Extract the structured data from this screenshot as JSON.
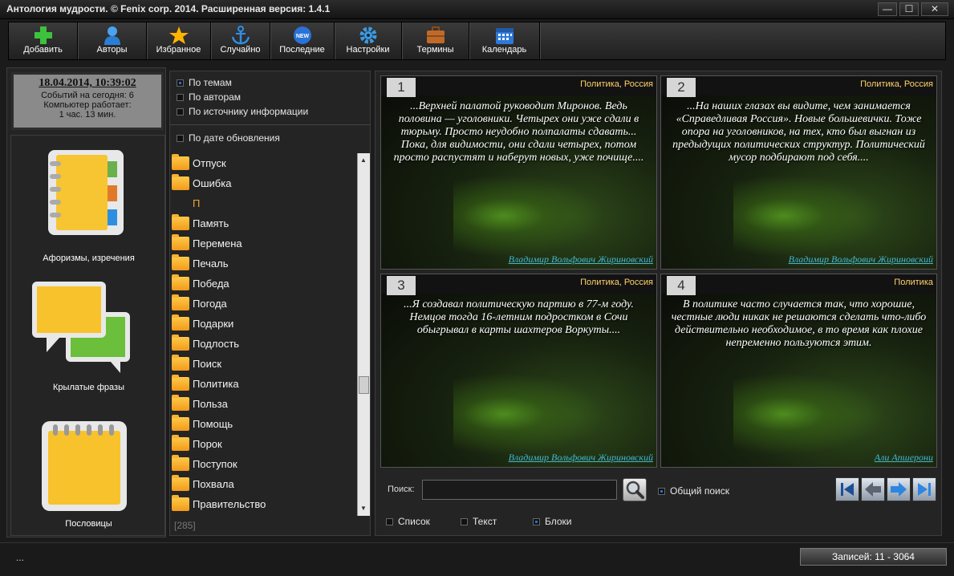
{
  "window": {
    "title": "Антология мудрости. © Fenix corp. 2014. Расширенная версия: 1.4.1",
    "min": "—",
    "max": "☐",
    "close": "✕"
  },
  "toolbar": [
    {
      "label": "Добавить",
      "icon": "plus-icon",
      "color": "#3cc23c"
    },
    {
      "label": "Авторы",
      "icon": "user-icon",
      "color": "#3a8fe0"
    },
    {
      "label": "Избранное",
      "icon": "star-icon",
      "color": "#ffb400"
    },
    {
      "label": "Случайно",
      "icon": "anchor-icon",
      "color": "#2e8fe6"
    },
    {
      "label": "Последние",
      "icon": "new-badge-icon",
      "color": "#2a72d6"
    },
    {
      "label": "Настройки",
      "icon": "gear-icon",
      "color": "#3a9be6"
    },
    {
      "label": "Термины",
      "icon": "briefcase-icon",
      "color": "#c06a2a"
    },
    {
      "label": "Календарь",
      "icon": "calendar-icon",
      "color": "#2e78d8"
    }
  ],
  "clock": {
    "datetime": "18.04.2014, 10:39:02",
    "events": "Событий на сегодня: 6",
    "uptime_label": "Компьютер работает:",
    "uptime": "1 час. 13 мин."
  },
  "categories": [
    {
      "label": "Афоризмы, изречения",
      "icon": "notebook-icon"
    },
    {
      "label": "Крылатые фразы",
      "icon": "speech-bubbles-icon"
    },
    {
      "label": "Пословицы",
      "icon": "notepad-icon"
    }
  ],
  "sort": {
    "by_topic": "По темам",
    "by_author": "По авторам",
    "by_source": "По источнику информации",
    "by_date": "По дате обновления"
  },
  "topics": [
    "Отпуск",
    "Ошибка",
    "П",
    "Память",
    "Перемена",
    "Печаль",
    "Победа",
    "Погода",
    "Подарки",
    "Подлость",
    "Поиск",
    "Политика",
    "Польза",
    "Помощь",
    "Порок",
    "Поступок",
    "Похвала",
    "Правительство"
  ],
  "topic_count": "[285]",
  "quotes": [
    {
      "num": "1",
      "tag": "Политика, Россия",
      "text": "...Верхней палатой руководит Миронов. Ведь половина — уголовники. Четырех они уже сдали в тюрьму. Просто неудобно полпалаты сдавать... Пока, для видимости, они сдали четырех, потом просто распустят и наберут новых, уже почище....",
      "author": "Владимир Вольфович Жириновский"
    },
    {
      "num": "2",
      "tag": "Политика, Россия",
      "text": "...На наших глазах вы видите, чем занимается «Справедливая Россия». Новые большевички. Тоже опора на уголовников, на тех, кто был выгнан из предыдущих политических структур. Политический мусор подбирают под себя....",
      "author": "Владимир Вольфович Жириновский"
    },
    {
      "num": "3",
      "tag": "Политика, Россия",
      "text": "...Я создавал политическую партию в 77-м году. Немцов тогда 16-летним подростком в Сочи обыгрывал в карты шахтеров Воркуты....",
      "author": "Владимир Вольфович Жириновский"
    },
    {
      "num": "4",
      "tag": "Политика",
      "text": "В политике часто случается так, что хорошие, честные люди никак не решаются сделать что-либо действительно необходимое, в то время как плохие непременно пользуются этим.",
      "author": "Али Апшерони"
    }
  ],
  "search": {
    "label": "Поиск:",
    "value": "",
    "global": "Общий поиск"
  },
  "views": {
    "list": "Список",
    "text": "Текст",
    "blocks": "Блоки"
  },
  "status": {
    "left": "...",
    "records": "Записей: 11 - 3064"
  }
}
